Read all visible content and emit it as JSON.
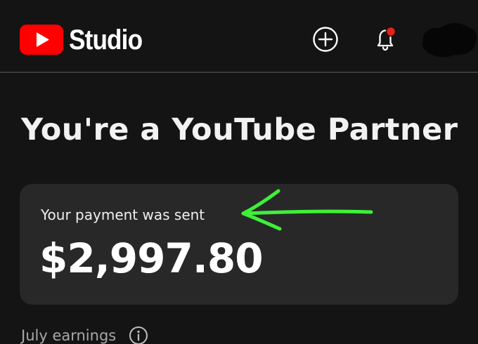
{
  "header": {
    "logo_text": "Studio",
    "logo_icon": "youtube-play-icon",
    "create_icon": "plus-circle-icon",
    "notifications_icon": "bell-icon",
    "notification_badge_color": "#e62117",
    "brand_color": "#ff0000"
  },
  "main": {
    "title": "You're a YouTube Partner",
    "payment_card": {
      "label": "Your payment was sent",
      "amount": "$2,997.80"
    },
    "annotation_arrow_color": "#3ef03a",
    "earnings": {
      "label": "July earnings",
      "info_icon": "info-icon"
    }
  }
}
